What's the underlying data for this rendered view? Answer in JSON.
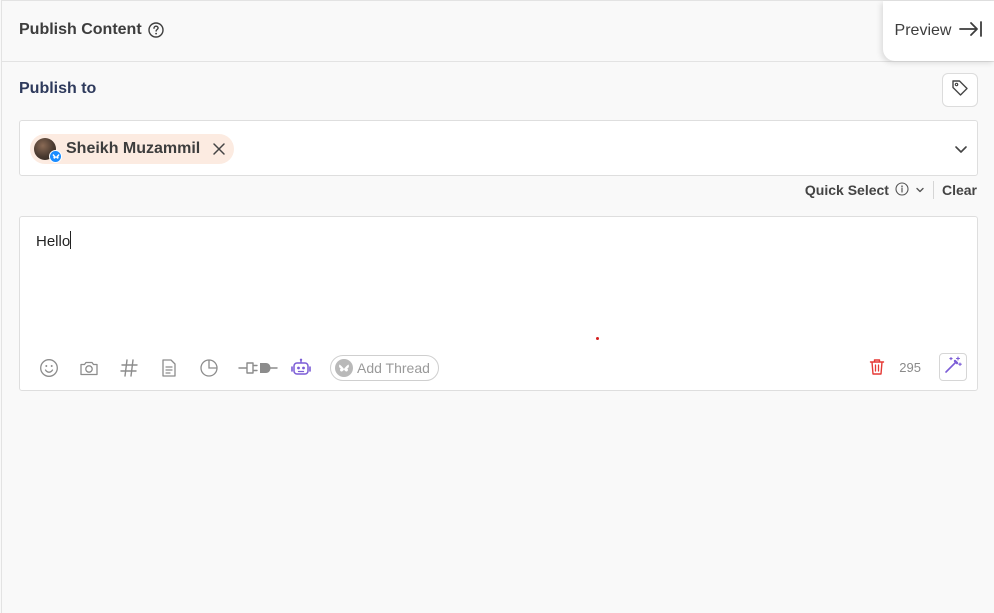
{
  "header": {
    "title": "Publish Content",
    "help_icon": "question-circle-icon",
    "preview_label": "Preview"
  },
  "publish_to": {
    "label": "Publish to",
    "tag_icon": "tag-icon"
  },
  "account_select": {
    "selected": [
      {
        "name": "Sheikh Muzammil",
        "platform": "bluesky"
      }
    ]
  },
  "quick_select": {
    "label": "Quick Select",
    "clear_label": "Clear"
  },
  "editor": {
    "text": "Hello",
    "character_count": "295",
    "add_thread_label": "Add Thread"
  },
  "colors": {
    "chip_bg": "#fcebe1",
    "publish_label": "#2e3a5c",
    "accent_purple": "#7b5cd6",
    "trash_red": "#e53935",
    "bluesky_blue": "#1a8cff"
  }
}
